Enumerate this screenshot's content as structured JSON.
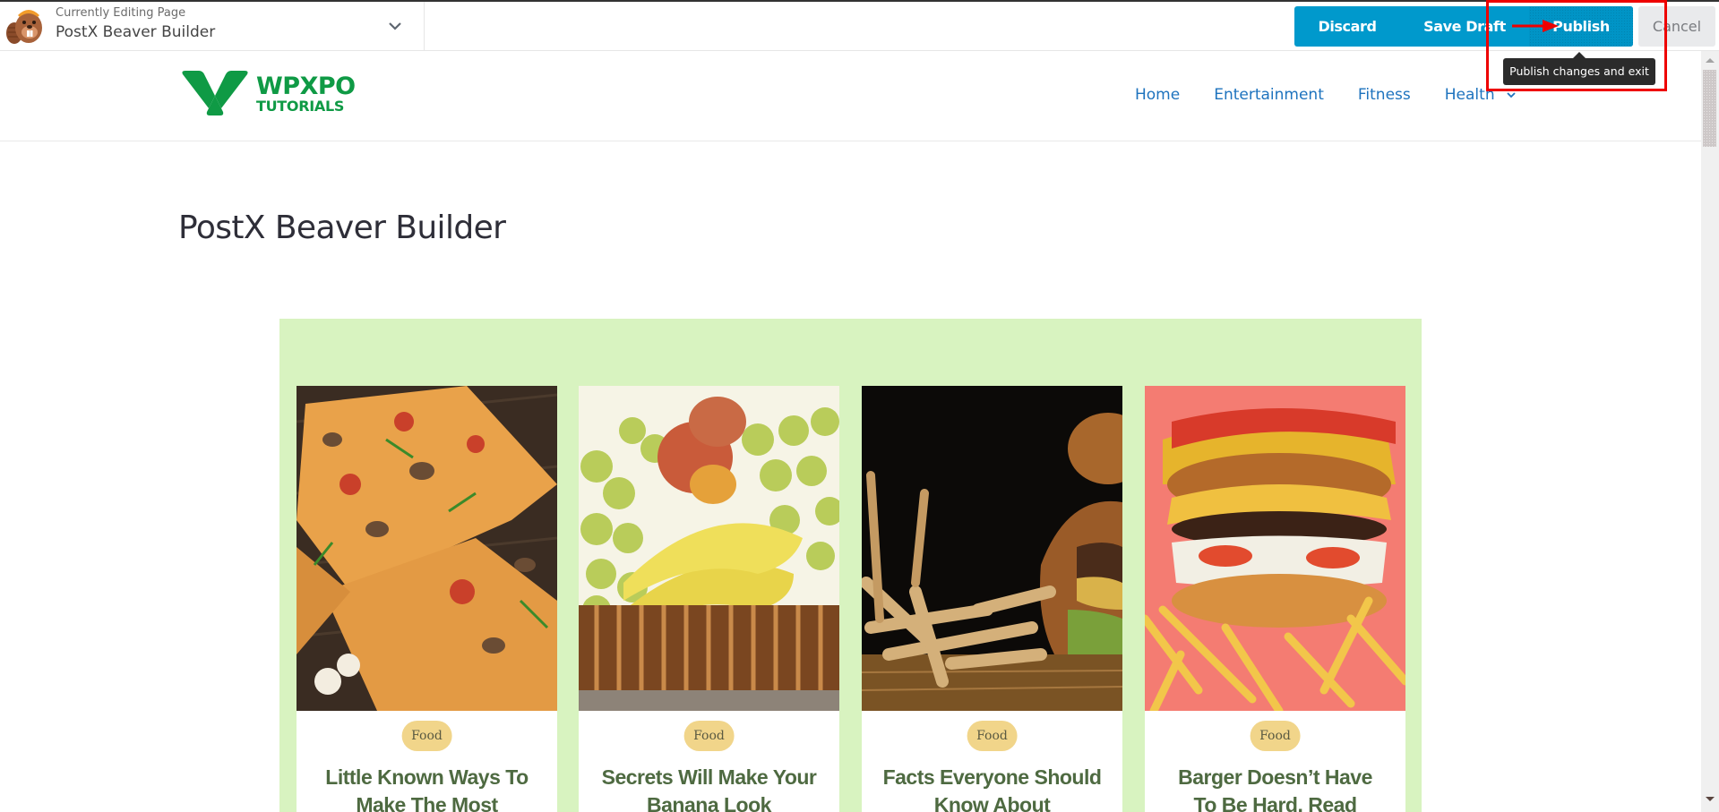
{
  "builder_bar": {
    "subtitle": "Currently Editing Page",
    "page_name": "PostX Beaver Builder",
    "buttons": {
      "discard": "Discard",
      "save_draft": "Save Draft",
      "publish": "Publish",
      "cancel": "Cancel"
    },
    "tooltip": "Publish changes and exit",
    "colors": {
      "primary": "#0099cc",
      "annotation": "#ee0000"
    }
  },
  "site": {
    "logo": {
      "line1": "WPXPO",
      "line2": "TUTORIALS",
      "color": "#0f9a45"
    },
    "nav": [
      {
        "label": "Home"
      },
      {
        "label": "Entertainment"
      },
      {
        "label": "Fitness"
      },
      {
        "label": "Health",
        "has_dropdown": true
      }
    ]
  },
  "page": {
    "title": "PostX Beaver Builder",
    "section_bg": "#d8f3c0",
    "posts": [
      {
        "category": "Food",
        "title": "Little Known Ways To Make The Most",
        "image": "pizza-slices"
      },
      {
        "category": "Food",
        "title": "Secrets Will Make Your Banana Look",
        "image": "fruit-basket"
      },
      {
        "category": "Food",
        "title": "Facts Everyone Should Know About",
        "image": "burger-and-fries-dark"
      },
      {
        "category": "Food",
        "title": "Barger Doesn’t Have To Be Hard. Read",
        "image": "burger-on-pink"
      }
    ]
  }
}
